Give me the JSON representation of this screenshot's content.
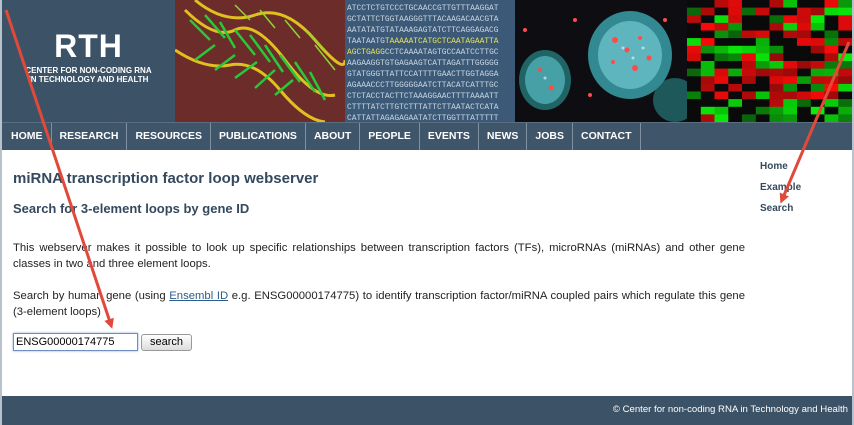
{
  "banner": {
    "logo_title": "RTH",
    "logo_sub_line1": "CENTER FOR NON-CODING RNA",
    "logo_sub_line2": "IN TECHNOLOGY AND HEALTH",
    "sequence_lines": [
      "ATCCTCTGTCCCTGCAACCGTTGTTTAAGGAT",
      "GCTATTCTGGTAAGGGTTTACAAGACAACGTA",
      "AATATATGTATAAAGAGTATCTTCAGGAGACG",
      "TAATAATGTAAAAATCATGCTCAATAGAATTA",
      "AGCTGAGGCCTCAAAATAGTGCCAATCCTTGC",
      "AAGAAGGTGTGAGAAGTCATTAGATTTGGGGG",
      "GTATGGGTTATTCCATTTTGAACTTGGTAGGA",
      "AGAAACCCTTGGGGGAATCTTACATCATTTGC",
      "CTCTACCTACTTCTAAAGGAACTTTTAAAATT",
      "CTTTTATCTTGTCTTTATTCTTAATACTCATA",
      "CATTATTAGAGAGAATATCTTGGTTTATTTTT"
    ],
    "highlight_sequence": "AAAAATCATGCTCAATAGAATTAAGCTGAGGC",
    "dna_image_icon": "dna-structure-illustration",
    "cell_image_icon": "fluorescent-cell-microscopy",
    "heatmap_icon": "expression-heatmap"
  },
  "nav": {
    "items": [
      {
        "id": "home",
        "label": "HOME"
      },
      {
        "id": "research",
        "label": "RESEARCH"
      },
      {
        "id": "resources",
        "label": "RESOURCES"
      },
      {
        "id": "publications",
        "label": "PUBLICATIONS"
      },
      {
        "id": "about",
        "label": "ABOUT"
      },
      {
        "id": "people",
        "label": "PEOPLE"
      },
      {
        "id": "events",
        "label": "EVENTS"
      },
      {
        "id": "news",
        "label": "NEWS"
      },
      {
        "id": "jobs",
        "label": "JOBS"
      },
      {
        "id": "contact",
        "label": "CONTACT"
      }
    ]
  },
  "main": {
    "title": "miRNA transcription factor loop webserver",
    "subtitle": "Search for 3-element loops by gene ID",
    "para1": "This webserver makes it possible to look up specific relationships between transcription factors (TFs), microRNAs (miRNAs) and other gene classes in two and three element loops.",
    "para2_before": "Search by human gene (using ",
    "para2_link": "Ensembl ID",
    "para2_after": " e.g. ENSG00000174775) to identify transcription factor/miRNA coupled pairs which regulate this gene (3-element loops)",
    "search_input_value": "ENSG00000174775",
    "search_button_label": "search"
  },
  "sidebar": {
    "home": "Home",
    "example": "Example",
    "search": "Search"
  },
  "footer": {
    "text": "© Center for non-coding RNA in Technology and Health"
  },
  "colors": {
    "header_bg": "#3c5266",
    "nav_bg": "#3f5569",
    "heading_text": "#34495e",
    "link": "#2a5d8e",
    "annotation_arrow": "#e04a3a"
  }
}
